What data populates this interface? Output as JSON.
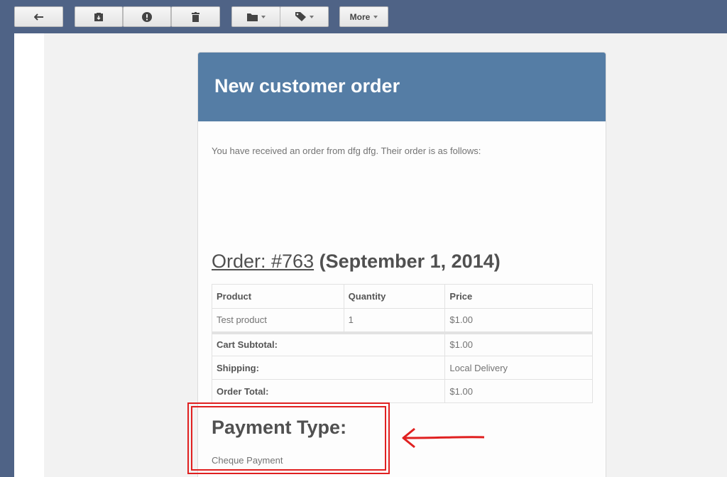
{
  "toolbar": {
    "more_label": "More",
    "buttons": [
      "reply",
      "archive",
      "report-spam",
      "delete",
      "move-to",
      "labels",
      "more"
    ]
  },
  "email": {
    "header_title": "New customer order",
    "intro_text": "You have received an order from dfg dfg. Their order is as follows:",
    "order_link_text": "Order: #763",
    "order_date_text": "(September 1, 2014)",
    "table": {
      "headers": [
        "Product",
        "Quantity",
        "Price"
      ],
      "rows": [
        [
          "Test product",
          "1",
          "$1.00"
        ]
      ],
      "totals": [
        {
          "label": "Cart Subtotal:",
          "value": "$1.00"
        },
        {
          "label": "Shipping:",
          "value": "Local Delivery"
        },
        {
          "label": "Order Total:",
          "value": "$1.00"
        }
      ]
    },
    "payment_title": "Payment Type:",
    "payment_value": "Cheque Payment"
  },
  "colors": {
    "toolbar_bg": "#4f6386",
    "header_bg": "#557da5",
    "annotation": "#e02020"
  }
}
